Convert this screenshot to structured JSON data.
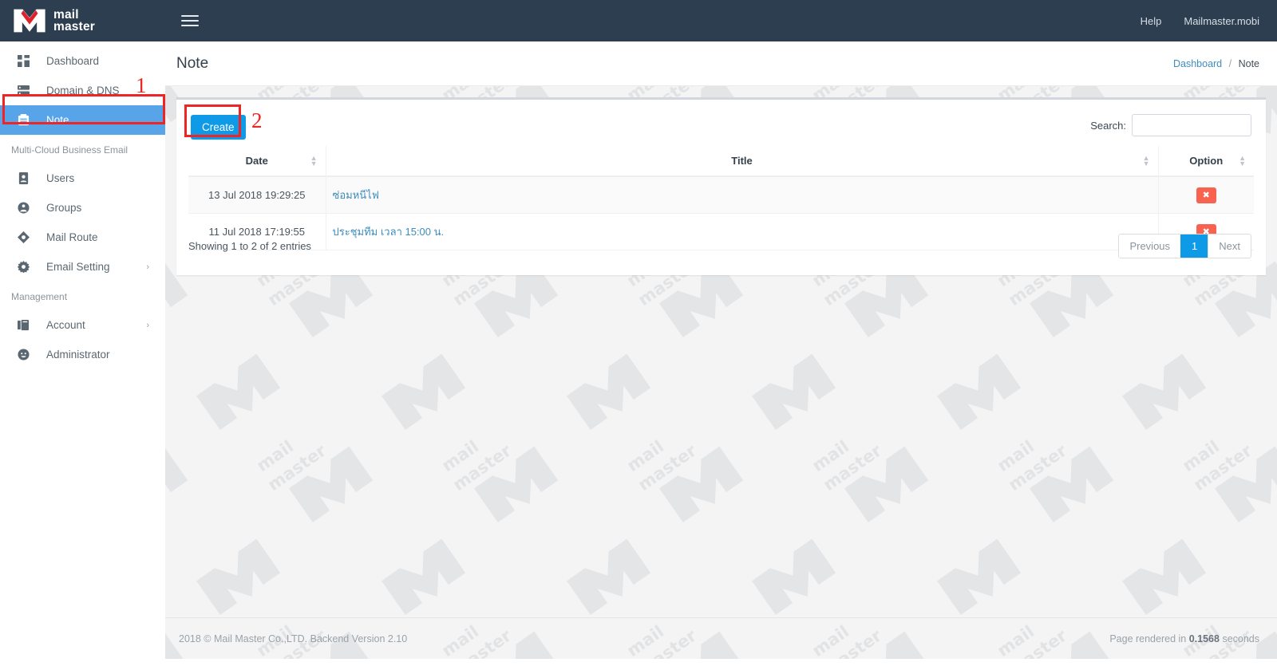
{
  "brand": {
    "line1": "mail",
    "line2": "master",
    "logo_white": "#ffffff",
    "logo_red": "#e0202a"
  },
  "topbar": {
    "menu_toggle_icon": "hamburger-icon",
    "help_label": "Help",
    "account_label": "Mailmaster.mobi",
    "bg": "#2d3e50"
  },
  "sidebar": {
    "items": [
      {
        "label": "Dashboard",
        "icon": "dashboard-grid-icon",
        "active": false,
        "caret": ""
      },
      {
        "label": "Domain & DNS",
        "icon": "server-icon",
        "active": false,
        "caret": ""
      },
      {
        "label": "Note",
        "icon": "clipboard-icon",
        "active": true,
        "caret": ""
      }
    ],
    "section_email": "Multi-Cloud Business Email",
    "email_items": [
      {
        "label": "Users",
        "icon": "user-card-icon",
        "active": false,
        "caret": ""
      },
      {
        "label": "Groups",
        "icon": "group-icon",
        "active": false,
        "caret": ""
      },
      {
        "label": "Mail Route",
        "icon": "route-diamond-icon",
        "active": false,
        "caret": ""
      },
      {
        "label": "Email Setting",
        "icon": "gear-icon",
        "active": false,
        "caret": "›"
      }
    ],
    "section_management": "Management",
    "management_items": [
      {
        "label": "Account",
        "icon": "book-icon",
        "active": false,
        "caret": "›"
      },
      {
        "label": "Administrator",
        "icon": "user-circle-icon",
        "active": false,
        "caret": ""
      }
    ],
    "active_bg": "#57a5e8"
  },
  "header": {
    "page_title": "Note",
    "breadcrumb_home": "Dashboard",
    "breadcrumb_sep": "/",
    "breadcrumb_current": "Note"
  },
  "toolbar": {
    "create_label": "Create",
    "create_color": "#0f9ae8",
    "search_label": "Search:",
    "search_value": "",
    "search_placeholder": ""
  },
  "table": {
    "columns": [
      "Date",
      "Title",
      "Option"
    ],
    "sort_icon": "sort-updown-icon",
    "delete_icon": "close-x-icon",
    "delete_color": "#f9624e",
    "rows": [
      {
        "date": "13 Jul 2018 19:29:25",
        "title": "ซ่อมหนีไฟ",
        "option": "✖"
      },
      {
        "date": "11 Jul 2018 17:19:55",
        "title": "ประชุมทีม เวลา 15:00 น.",
        "option": "✖"
      }
    ]
  },
  "footer_table": {
    "showing": "Showing 1 to 2 of 2 entries",
    "previous": "Previous",
    "page_current": "1",
    "next": "Next"
  },
  "footer": {
    "copyright": "2018 © Mail Master Co.,LTD. Backend Version 2.10",
    "render_prefix": "Page rendered in",
    "render_time": "0.1568",
    "render_suffix": "seconds"
  },
  "annotations": {
    "step1": "1",
    "step2": "2",
    "color": "#ee2524"
  }
}
